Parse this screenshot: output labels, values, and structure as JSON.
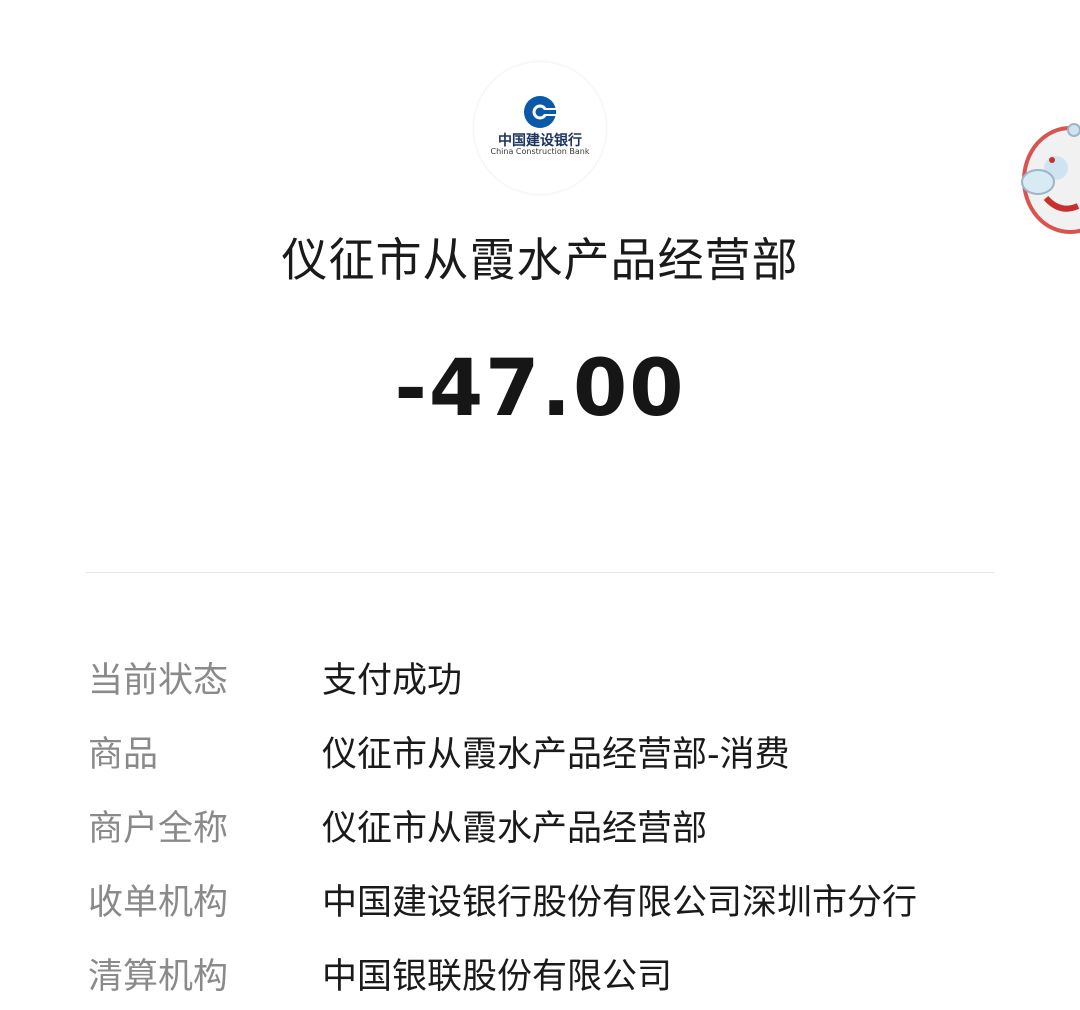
{
  "bank_logo": {
    "name_cn": "中国建设银行",
    "name_en": "China Construction Bank",
    "icon": "ccb-logo-icon",
    "brand_color": "#0a59a8"
  },
  "merchant_name": "仪征市从霞水产品经营部",
  "amount": "-47.00",
  "details": [
    {
      "label": "当前状态",
      "value": "支付成功"
    },
    {
      "label": "商品",
      "value": "仪征市从霞水产品经营部-消费"
    },
    {
      "label": "商户全称",
      "value": "仪征市从霞水产品经营部"
    },
    {
      "label": "收单机构",
      "value": "中国建设银行股份有限公司深圳市分行"
    },
    {
      "label": "清算机构",
      "value": "中国银联股份有限公司"
    }
  ],
  "floating_widget": {
    "icon": "mascot-icon"
  }
}
